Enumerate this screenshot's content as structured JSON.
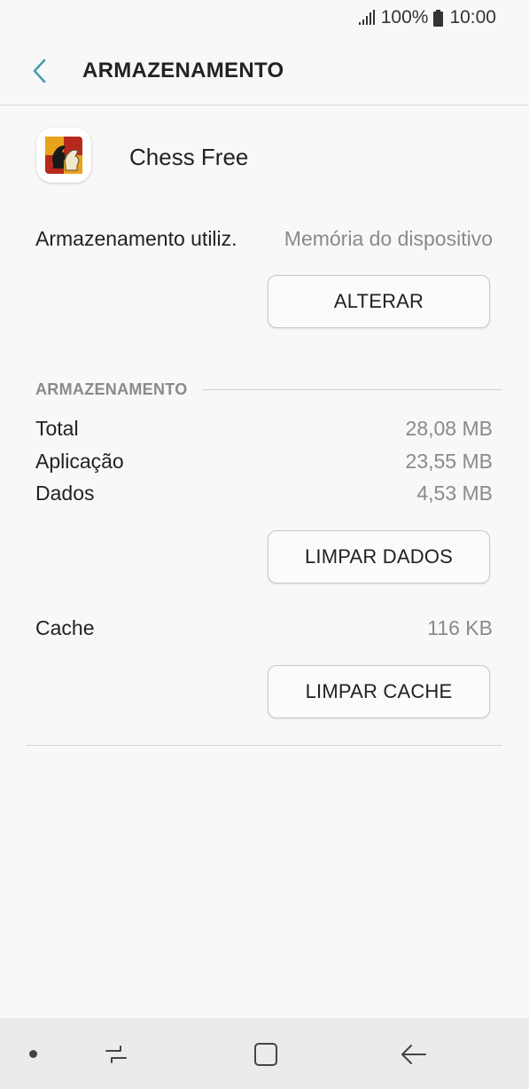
{
  "status_bar": {
    "battery": "100%",
    "time": "10:00",
    "icons": [
      "signal-icon",
      "battery-icon"
    ]
  },
  "app_bar": {
    "title": "ARMAZENAMENTO",
    "back_icon": "back-chevron-icon"
  },
  "app": {
    "name": "Chess Free",
    "icon": "chess-app-icon"
  },
  "storage_used": {
    "label": "Armazenamento utiliz.",
    "value": "Memória do dispositivo",
    "change_button": "ALTERAR"
  },
  "storage_section": {
    "header": "ARMAZENAMENTO",
    "rows": [
      {
        "label": "Total",
        "value": "28,08 MB"
      },
      {
        "label": "Aplicação",
        "value": "23,55 MB"
      },
      {
        "label": "Dados",
        "value": "4,53 MB"
      }
    ],
    "clear_data_button": "LIMPAR DADOS"
  },
  "cache": {
    "label": "Cache",
    "value": "116 KB",
    "clear_cache_button": "LIMPAR CACHE"
  },
  "nav_bar": {
    "icons": [
      "nav-dot-icon",
      "recents-icon",
      "home-icon",
      "back-icon"
    ]
  },
  "colors": {
    "accent": "#4a9bb0",
    "background": "#f8f8f8",
    "nav_background": "#ebebeb",
    "secondary_text": "#8a8a8a"
  }
}
